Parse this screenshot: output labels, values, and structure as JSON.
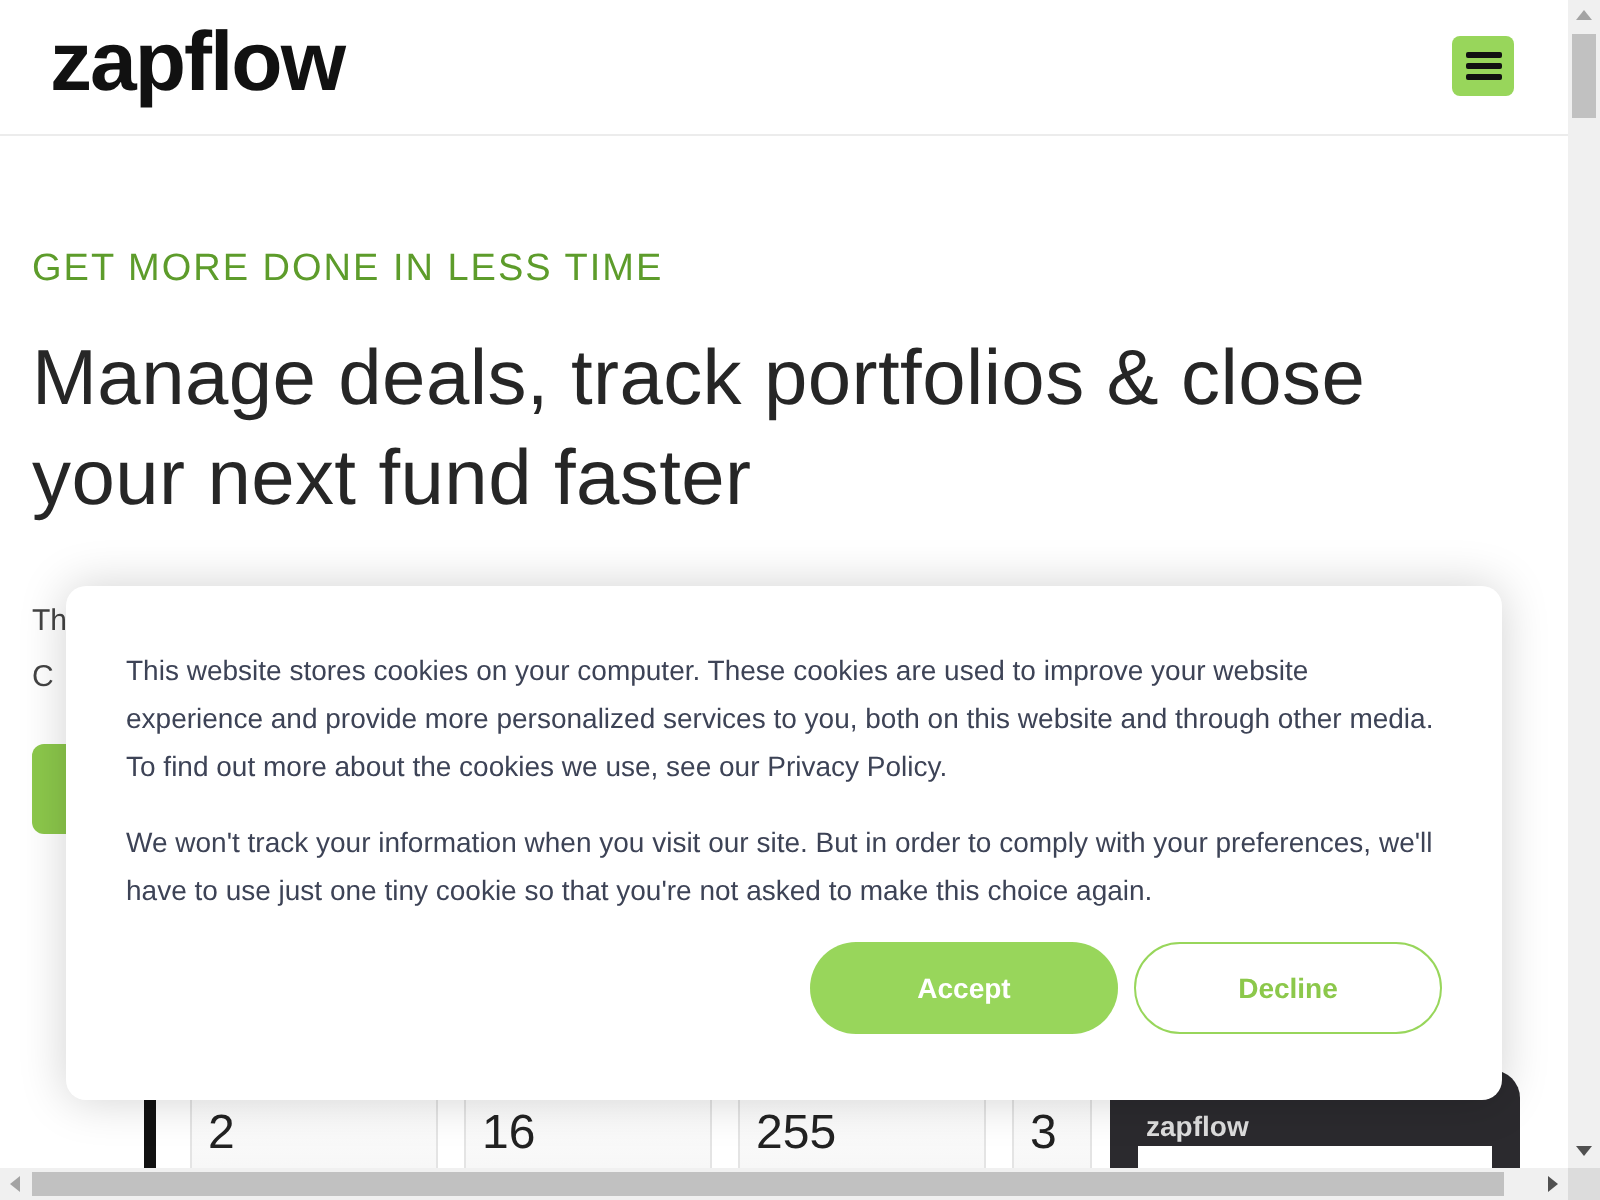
{
  "header": {
    "logo": "zapflow"
  },
  "hero": {
    "eyebrow": "GET MORE DONE IN LESS TIME",
    "headline": "Manage deals, track portfolios & close your next fund faster",
    "intro_lines": [
      "Th",
      "C"
    ]
  },
  "stats": [
    "2",
    "16",
    "255",
    "3"
  ],
  "phone": {
    "logo": "zapflow"
  },
  "cookie_banner": {
    "paragraphs": [
      "This website stores cookies on your computer. These cookies are used to improve your website experience and provide more personalized services to you, both on this website and through other media. To find out more about the cookies we use, see our Privacy Policy.",
      "We won't track your information when you visit our site. But in order to comply with your preferences, we'll have to use just one tiny cookie so that you're not asked to make this choice again."
    ],
    "buttons": [
      {
        "label": "Accept",
        "kind": "primary"
      },
      {
        "label": "Decline",
        "kind": "secondary"
      }
    ]
  }
}
